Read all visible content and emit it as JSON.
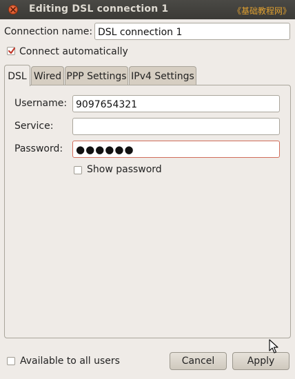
{
  "window": {
    "title": "Editing DSL connection 1",
    "watermark": "《基础教程网》"
  },
  "connection": {
    "name_label": "Connection name:",
    "name_value": "DSL connection 1",
    "auto_connect_label": "Connect automatically",
    "auto_connect_checked": true
  },
  "tabs": [
    {
      "label": "DSL",
      "active": true
    },
    {
      "label": "Wired",
      "active": false
    },
    {
      "label": "PPP Settings",
      "active": false
    },
    {
      "label": "IPv4 Settings",
      "active": false
    }
  ],
  "dsl": {
    "username_label": "Username:",
    "username_value": "9097654321",
    "service_label": "Service:",
    "service_value": "",
    "password_label": "Password:",
    "password_value": "●●●●●●",
    "show_password_label": "Show password",
    "show_password_checked": false
  },
  "footer": {
    "available_all_users_label": "Available to all users",
    "available_all_users_checked": false,
    "cancel_label": "Cancel",
    "apply_label": "Apply"
  }
}
